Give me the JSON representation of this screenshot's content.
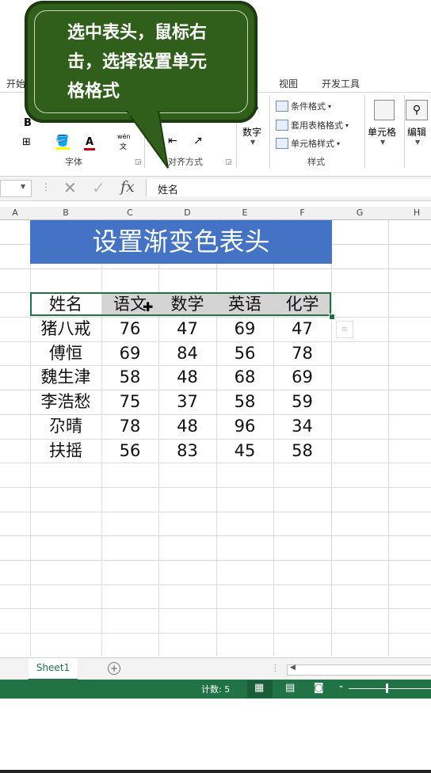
{
  "callout": {
    "line1": "选中表头，鼠标右",
    "line2": "击，选择设置单元",
    "line3": "格格式"
  },
  "ribbon": {
    "tabs": {
      "home": "开始",
      "view": "视图",
      "developer": "开发工具"
    },
    "groups": {
      "font": "字体",
      "alignment": "对齐方式",
      "styles": "样式"
    },
    "buttons": {
      "conditional_format": "条件格式",
      "table_format": "套用表格格式",
      "cell_styles": "单元格样式",
      "number": "数字",
      "cells": "单元格",
      "edit": "编辑",
      "phonetic_top": "wén",
      "phonetic_bottom": "文",
      "bold": "B",
      "font_color": "A",
      "number_symbol": "%"
    }
  },
  "formula": {
    "fx": "fx",
    "content": "姓名"
  },
  "columns": [
    "A",
    "B",
    "C",
    "D",
    "E",
    "F",
    "G",
    "H"
  ],
  "sheet": {
    "title": "设置渐变色表头",
    "headers": [
      "姓名",
      "语文",
      "数学",
      "英语",
      "化学"
    ],
    "rows": [
      [
        "猪八戒",
        "76",
        "47",
        "69",
        "47"
      ],
      [
        "傅恒",
        "69",
        "84",
        "56",
        "78"
      ],
      [
        "魏生津",
        "58",
        "48",
        "68",
        "69"
      ],
      [
        "李浩愁",
        "75",
        "37",
        "58",
        "59"
      ],
      [
        "尕晴",
        "78",
        "48",
        "96",
        "34"
      ],
      [
        "扶摇",
        "56",
        "83",
        "45",
        "58"
      ]
    ]
  },
  "sheet_tab": "Sheet1",
  "status": {
    "count": "计数: 5"
  },
  "colors": {
    "title_bg": "#4472c4",
    "status_bar": "#217346",
    "callout": "#2f5f1a"
  }
}
